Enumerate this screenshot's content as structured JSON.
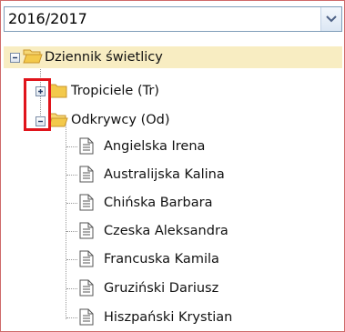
{
  "year_select": {
    "value": "2016/2017"
  },
  "tree": {
    "root": {
      "label": "Dziennik świetlicy"
    },
    "groups": [
      {
        "label": "Tropiciele (Tr)",
        "state": "collapsed"
      },
      {
        "label": "Odkrywcy (Od)",
        "state": "expanded"
      }
    ],
    "students": [
      "Angielska Irena",
      "Australijska Kalina",
      "Chińska Barbara",
      "Czeska Aleksandra",
      "Francuska Kamila",
      "Gruziński Dariusz",
      "Hiszpański Krystian"
    ]
  },
  "colors": {
    "selected_row": "#f8edc2",
    "highlight_box": "#e0141b",
    "folder": "#f3c94b"
  }
}
